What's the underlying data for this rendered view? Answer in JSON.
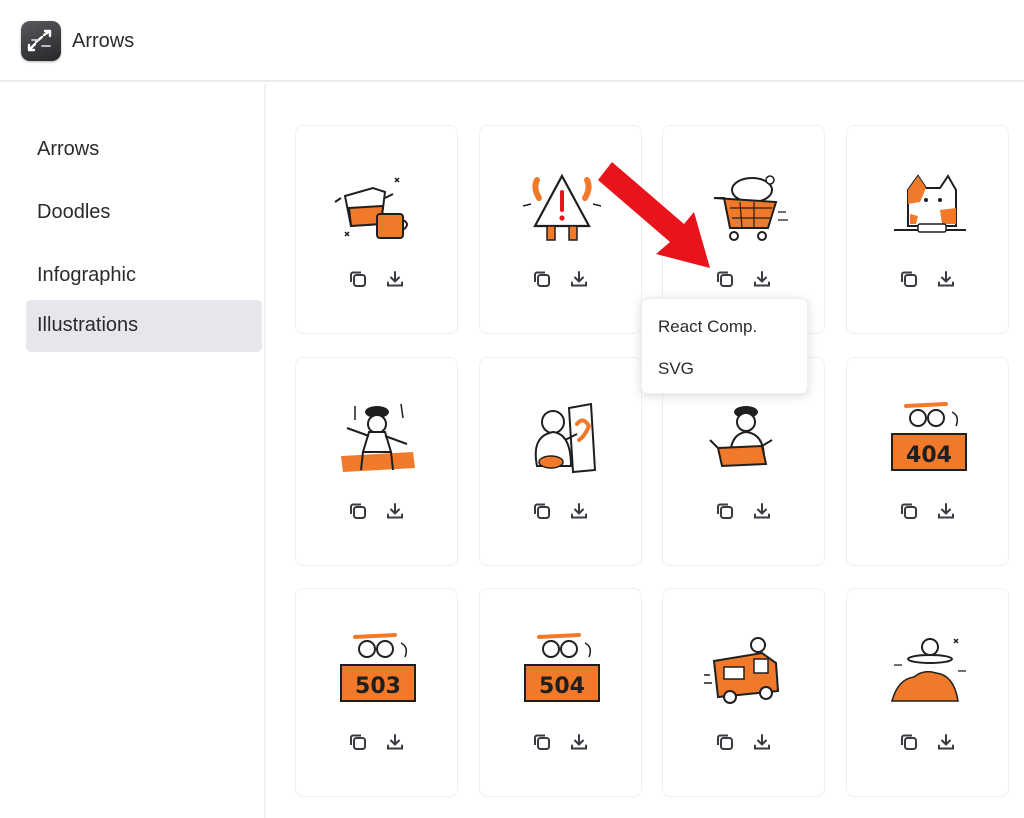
{
  "app": {
    "title": "Arrows",
    "logo_icon": "arrows-logo-icon"
  },
  "sidebar": {
    "items": [
      {
        "label": "Arrows",
        "active": false
      },
      {
        "label": "Doodles",
        "active": false
      },
      {
        "label": "Infographic",
        "active": false
      },
      {
        "label": "Illustrations",
        "active": true
      }
    ]
  },
  "grid": {
    "cards": [
      {
        "name": "coffee-pot",
        "text": ""
      },
      {
        "name": "warning-sign",
        "text": ""
      },
      {
        "name": "shopping-cart",
        "text": ""
      },
      {
        "name": "cat",
        "text": ""
      },
      {
        "name": "dancing-person",
        "text": ""
      },
      {
        "name": "painter",
        "text": ""
      },
      {
        "name": "box-person",
        "text": ""
      },
      {
        "name": "error-404",
        "text": "404"
      },
      {
        "name": "error-503",
        "text": "503"
      },
      {
        "name": "error-504",
        "text": "504"
      },
      {
        "name": "delivery-truck",
        "text": ""
      },
      {
        "name": "ufo",
        "text": ""
      }
    ],
    "actions": {
      "copy_icon": "copy-icon",
      "download_icon": "download-icon"
    }
  },
  "dropdown": {
    "options": [
      "React Comp.",
      "SVG"
    ]
  },
  "annotation": {
    "icon": "red-arrow-pointer",
    "color": "#e8131b"
  },
  "colors": {
    "accent": "#f07a2a",
    "ink": "#1f1f1f",
    "active_bg": "#e6e6ec"
  }
}
